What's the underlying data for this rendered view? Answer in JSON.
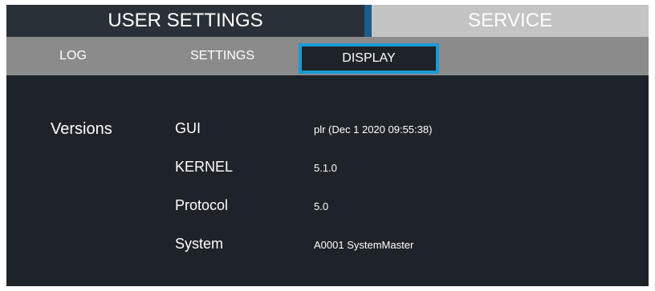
{
  "top_tabs": {
    "user_settings": "USER SETTINGS",
    "service": "SERVICE"
  },
  "sub_tabs": {
    "log": "LOG",
    "settings": "SETTINGS",
    "display": "DISPLAY",
    "active": "DISPLAY"
  },
  "versions": {
    "title": "Versions",
    "rows": [
      {
        "label": "GUI",
        "value": "plr (Dec 1 2020 09:55:38)"
      },
      {
        "label": "KERNEL",
        "value": "5.1.0"
      },
      {
        "label": "Protocol",
        "value": "5.0"
      },
      {
        "label": "System",
        "value": "A0001 SystemMaster"
      }
    ]
  },
  "colors": {
    "background": "#1d2329",
    "active_tab_border": "#1b9ad6",
    "top_accent": "#1a5f8c",
    "subbar": "#8b8b8b",
    "service_tab": "#c4c4c4"
  }
}
